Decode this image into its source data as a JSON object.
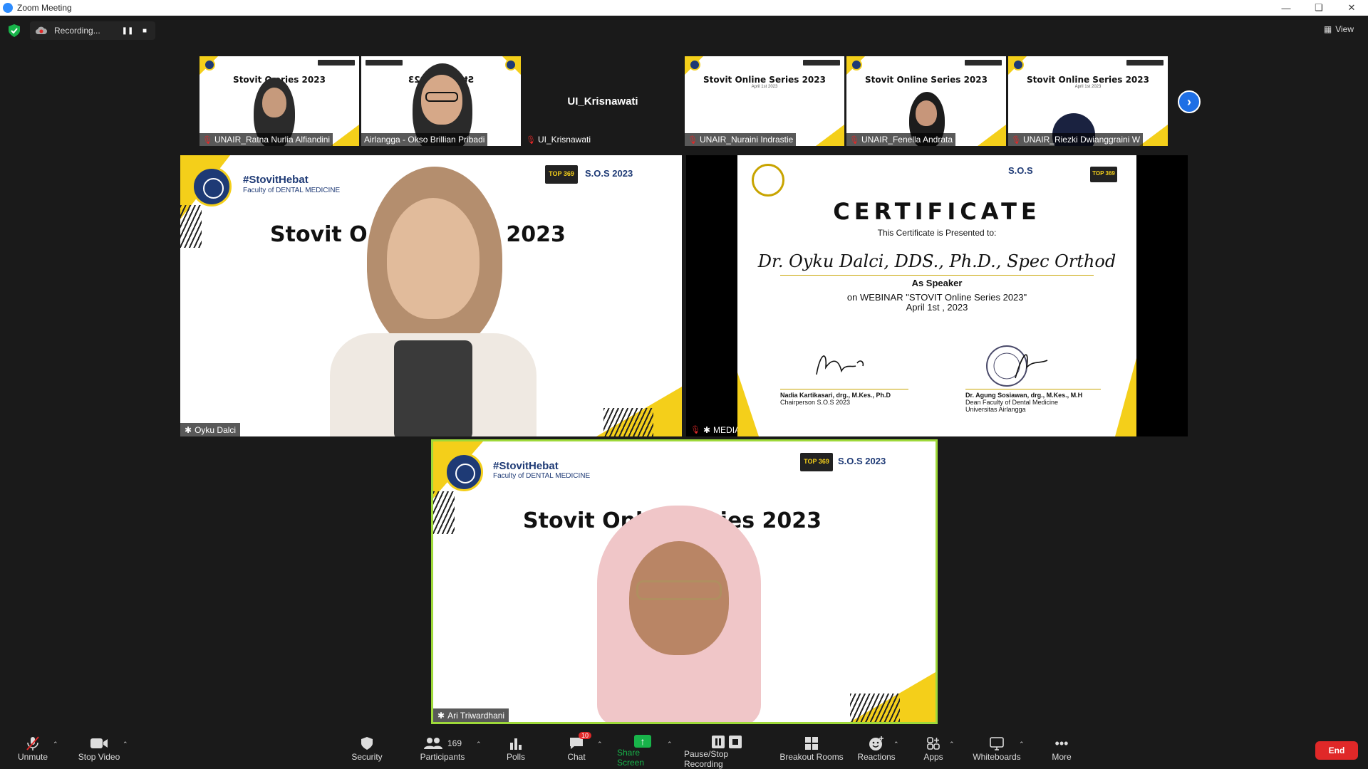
{
  "window": {
    "title": "Zoom Meeting"
  },
  "recording": {
    "label": "Recording..."
  },
  "view": {
    "label": "View"
  },
  "thumbnails": [
    {
      "name": "UNAIR_Ratna Nurlia Alfiandini",
      "slide_title": "Stovit O    eries 2023"
    },
    {
      "name": "Airlangga - Okso Brillian Pribadi",
      "slide_title": "Stovit O    2023"
    },
    {
      "name": "UI_Krisnawati",
      "display": "UI_Krisnawati"
    },
    {
      "name": "UNAIR_Nuraini Indrastie",
      "slide_title": "Stovit Online Series 2023",
      "slide_sub": "April 1st 2023"
    },
    {
      "name": "UNAIR_Fenella Andrata",
      "slide_title": "Stovit Online Series 2023",
      "slide_sub": "April 1st 2023"
    },
    {
      "name": "UNAIR_Riezki Dwianggraini W",
      "slide_title": "Stovit Online Series 2023",
      "slide_sub": "April 1st 2023"
    }
  ],
  "tiles": {
    "speaker1": {
      "name": "Oyku Dalci",
      "hashtag": "#StovitHebat",
      "faculty": "Faculty of DENTAL MEDICINE",
      "slide_title": "Stovit O             ies 2023",
      "top": "TOP 369",
      "sos": "S.O.S 2023"
    },
    "media": {
      "name": "MEDIA"
    },
    "speaker2": {
      "name": "Ari Triwardhani",
      "hashtag": "#StovitHebat",
      "faculty": "Faculty of DENTAL MEDICINE",
      "slide_title": "Stovit Onl       eries 2023",
      "top": "TOP 369",
      "sos": "S.O.S 2023"
    }
  },
  "certificate": {
    "logo": "S.O.S",
    "title": "CERTIFICATE",
    "presented": "This Certificate is Presented to:",
    "honoree": "Dr. Oyku Dalci, DDS., Ph.D., Spec Orthod",
    "role": "As Speaker",
    "webinar": "on WEBINAR \"STOVIT Online Series 2023\"",
    "date": "April 1st , 2023",
    "signer1_name": "Nadia Kartikasari, drg., M.Kes., Ph.D",
    "signer1_title": "Chairperson S.O.S 2023",
    "signer2_name": "Dr. Agung Sosiawan, drg., M.Kes., M.H",
    "signer2_title": "Dean Faculty of Dental Medicine",
    "signer2_org": "Universitas Airlangga"
  },
  "toolbar": {
    "unmute": "Unmute",
    "stop_video": "Stop Video",
    "security": "Security",
    "participants": "Participants",
    "participants_count": "169",
    "polls": "Polls",
    "chat": "Chat",
    "chat_badge": "10",
    "share_screen": "Share Screen",
    "pause_recording": "Pause/Stop Recording",
    "breakout": "Breakout Rooms",
    "reactions": "Reactions",
    "apps": "Apps",
    "whiteboards": "Whiteboards",
    "more": "More",
    "end": "End"
  },
  "colors": {
    "accent": "#2d8cff",
    "end": "#e02828",
    "share": "#18b44a",
    "brand_navy": "#1e3a75",
    "brand_yellow": "#f4cf1a",
    "active_border": "#9ed93a"
  }
}
